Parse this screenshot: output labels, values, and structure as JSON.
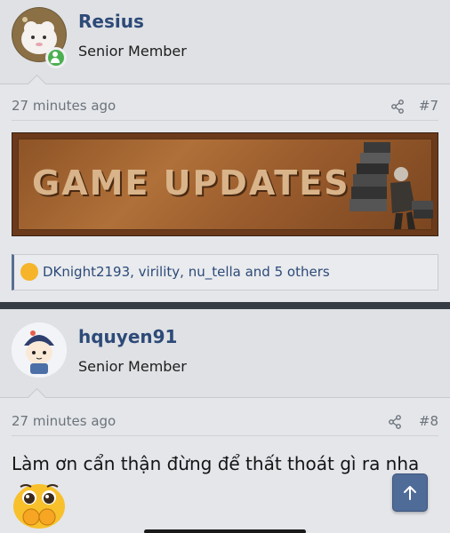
{
  "posts": [
    {
      "username": "Resius",
      "user_title": "Senior Member",
      "time": "27 minutes ago",
      "post_number": "#7",
      "banner_text": "GAME UPDATES",
      "reactions": "DKnight2193, virility, nu_tella and 5 others"
    },
    {
      "username": "hquyen91",
      "user_title": "Senior Member",
      "time": "27 minutes ago",
      "post_number": "#8",
      "content": "Làm ơn cẩn thận đừng để thất thoát gì ra nha"
    }
  ],
  "icons": {
    "share": "share-icon",
    "scroll_top": "arrow-up-icon",
    "online": "online-status-icon"
  },
  "colors": {
    "username": "#2d4a78",
    "accent": "#4f6b98",
    "online": "#4caf50"
  }
}
